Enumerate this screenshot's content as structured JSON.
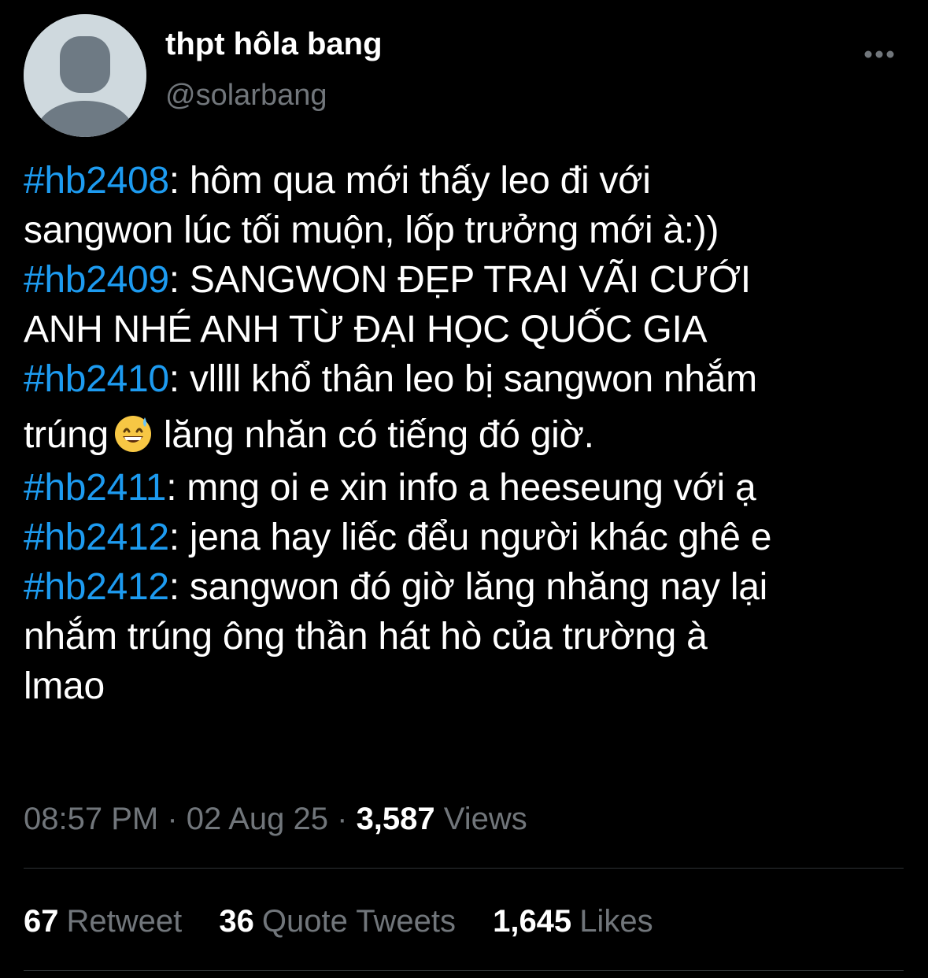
{
  "author": {
    "display_name": "thpt hôla bang",
    "handle": "@solarbang"
  },
  "icons": {
    "avatar": "default-avatar-silhouette",
    "more": "more-options-dots-icon",
    "emoji": "grinning-face-with-sweat-emoji"
  },
  "colors": {
    "background": "#000000",
    "text": "#ffffff",
    "muted": "#71767b",
    "hashtag": "#1d9bf0",
    "divider": "#2f3336"
  },
  "tweet": {
    "lines": [
      {
        "hashtag": "#hb2408",
        "text": ": hôm qua mới thấy leo đi với"
      },
      {
        "text": "sangwon lúc tối muộn, lốp trưởng mới à:))"
      },
      {
        "hashtag": "#hb2409",
        "text": ": SANGWON ĐẸP TRAI VÃI CƯỚI"
      },
      {
        "text": "ANH NHÉ ANH TỪ ĐẠI HỌC QUỐC GIA"
      },
      {
        "hashtag": "#hb2410",
        "text": ": vllll khổ thân leo bị sangwon nhắm"
      },
      {
        "text_before_emoji": "trúng",
        "text_after_emoji": "lăng nhăn có tiếng đó giờ."
      },
      {
        "hashtag": "#hb2411",
        "text": ": mng oi e xin info a heeseung với ạ"
      },
      {
        "hashtag": "#hb2412",
        "text": ": jena hay liếc đểu người khác ghê e"
      },
      {
        "hashtag": "#hb2412",
        "text": ": sangwon đó giờ lăng nhăng nay lại"
      },
      {
        "text": "nhắm trúng ông thần hát hò của trường à"
      },
      {
        "text": "lmao"
      }
    ]
  },
  "meta": {
    "time": "08:57 PM",
    "separator": "·",
    "date": "02 Aug 25",
    "views_count": "3,587",
    "views_label": "Views"
  },
  "stats": {
    "retweets_count": "67",
    "retweets_label": "Retweet",
    "quotes_count": "36",
    "quotes_label": "Quote Tweets",
    "likes_count": "1,645",
    "likes_label": "Likes"
  }
}
